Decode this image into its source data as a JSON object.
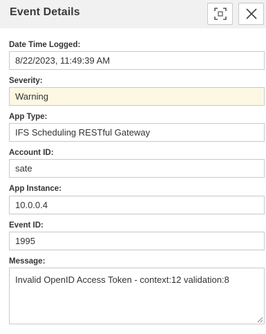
{
  "header": {
    "title": "Event Details",
    "icons": [
      "fullscreen-icon",
      "close-icon"
    ]
  },
  "fields": {
    "date_time_logged": {
      "label": "Date Time Logged:",
      "value": "8/22/2023, 11:49:39 AM"
    },
    "severity": {
      "label": "Severity:",
      "value": "Warning"
    },
    "app_type": {
      "label": "App Type:",
      "value": "IFS Scheduling RESTful Gateway"
    },
    "account_id": {
      "label": "Account ID:",
      "value": "sate"
    },
    "app_instance": {
      "label": "App Instance:",
      "value": "10.0.0.4"
    },
    "event_id": {
      "label": "Event ID:",
      "value": "1995"
    },
    "message": {
      "label": "Message:",
      "value": "Invalid OpenID Access Token - context:12 validation:8"
    }
  },
  "colors": {
    "header_bg": "#f1f1f1",
    "warning_bg": "#fcf8e3",
    "border": "#c9c9c9"
  }
}
